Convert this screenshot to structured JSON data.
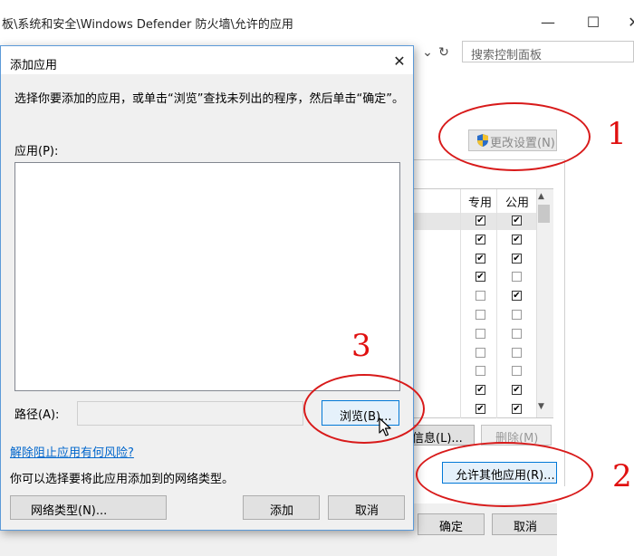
{
  "background_window": {
    "title": "板\\系统和安全\\Windows Defender 防火墙\\允许的应用",
    "search_placeholder": "搜索控制面板",
    "change_settings_label": "更改设置(N)",
    "table": {
      "columns": [
        "专用",
        "公用"
      ],
      "rows": [
        {
          "private": true,
          "public": true
        },
        {
          "private": true,
          "public": true
        },
        {
          "private": true,
          "public": true
        },
        {
          "private": true,
          "public": false
        },
        {
          "private": false,
          "public": true
        },
        {
          "private": false,
          "public": false
        },
        {
          "private": false,
          "public": false
        },
        {
          "private": false,
          "public": false
        },
        {
          "private": false,
          "public": false
        },
        {
          "private": true,
          "public": true
        },
        {
          "private": true,
          "public": true
        }
      ]
    },
    "details_label": "信息(L)...",
    "delete_label": "删除(M)",
    "allow_other_label": "允许其他应用(R)...",
    "ok_label": "确定",
    "cancel_label": "取消"
  },
  "dialog": {
    "title": "添加应用",
    "description": "选择你要添加的应用，或单击“浏览”查找未列出的程序，然后单击“确定”。",
    "apps_label": "应用(P):",
    "path_label": "路径(A):",
    "path_value": "",
    "browse_label": "浏览(B)...",
    "risk_link": "解除阻止应用有何风险?",
    "network_desc": "你可以选择要将此应用添加到的网络类型。",
    "network_type_label": "网络类型(N)...",
    "add_label": "添加",
    "cancel_label": "取消"
  },
  "annotations": {
    "num1": "1",
    "num2": "2",
    "num3": "3",
    "color": "#e01010"
  }
}
